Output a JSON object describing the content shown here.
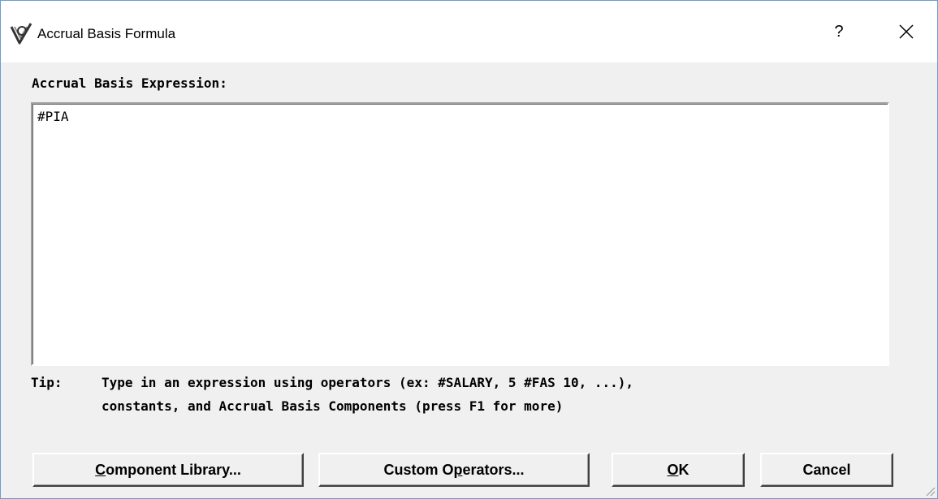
{
  "window": {
    "title": "Accrual Basis Formula",
    "help_glyph": "?",
    "close_glyph": "×"
  },
  "expression": {
    "label": "Accrual Basis Expression:",
    "value": "#PIA"
  },
  "tip": {
    "label": "Tip:",
    "line1": "Type in an expression using operators (ex: #SALARY, 5 #FAS 10, ...),",
    "line2": "constants, and Accrual Basis Components (press F1 for more)"
  },
  "buttons": {
    "component_library": {
      "mnemonic": "C",
      "rest": "omponent Library..."
    },
    "custom_operators": {
      "before": "Custom O",
      "mnemonic": "p",
      "after": "erators..."
    },
    "ok": {
      "mnemonic": "O",
      "rest": "K"
    },
    "cancel": "Cancel"
  },
  "icons": {
    "app": "app-logo-icon",
    "help": "help-icon",
    "close": "close-icon",
    "resize": "resize-grip-icon"
  },
  "colors": {
    "window_border": "#6b9bd1",
    "dialog_background": "#f0f0f0",
    "titlebar_background": "#ffffff"
  }
}
